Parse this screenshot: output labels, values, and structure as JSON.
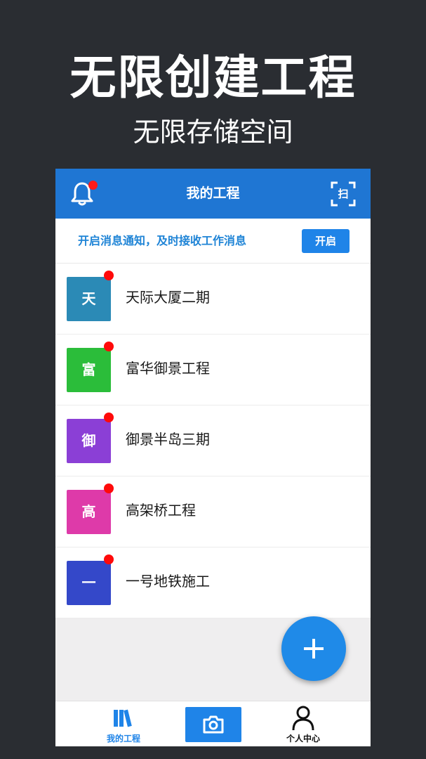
{
  "promo": {
    "title": "无限创建工程",
    "subtitle": "无限存储空间"
  },
  "header": {
    "title": "我的工程",
    "scan_label": "扫",
    "bell_icon": "bell-icon",
    "scan_icon": "scan-icon"
  },
  "notice": {
    "text": "开启消息通知，及时接收工作消息",
    "button_label": "开启"
  },
  "projects": [
    {
      "initial": "天",
      "name": "天际大厦二期",
      "color": "#2b8ab6"
    },
    {
      "initial": "富",
      "name": "富华御景工程",
      "color": "#2bbd3a"
    },
    {
      "initial": "御",
      "name": "御景半岛三期",
      "color": "#8b3fd6"
    },
    {
      "initial": "高",
      "name": "高架桥工程",
      "color": "#de3aa9"
    },
    {
      "initial": "一",
      "name": "一号地铁施工",
      "color": "#3448c9"
    }
  ],
  "bottom_nav": {
    "projects_label": "我的工程",
    "profile_label": "个人中心",
    "projects_icon": "books-icon",
    "camera_icon": "camera-icon",
    "profile_icon": "person-icon"
  },
  "colors": {
    "accent": "#1f76d3",
    "button": "#1f84e8",
    "badge": "#ff0a0a"
  }
}
